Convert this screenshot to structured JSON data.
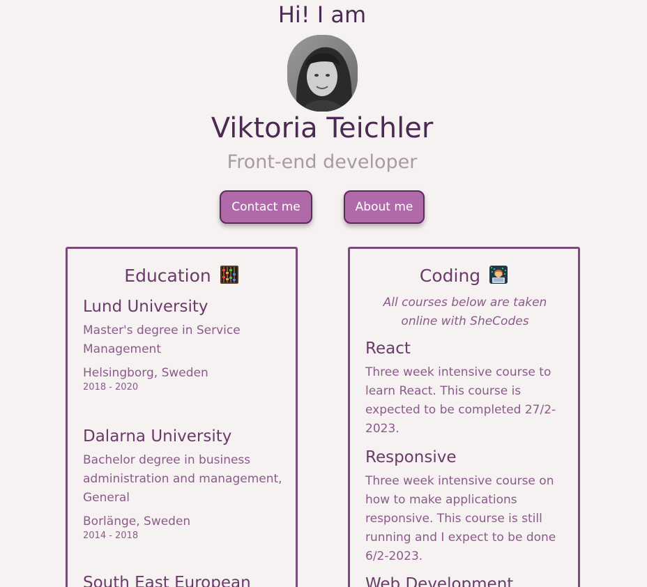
{
  "hero": {
    "greeting": "Hi! I am",
    "name": "Viktoria Teichler",
    "role": "Front-end developer"
  },
  "buttons": {
    "contact_label": "Contact me",
    "about_label": "About me"
  },
  "education": {
    "title": "Education",
    "icon": "abacus-icon",
    "items": [
      {
        "school": "Lund University",
        "degree": "Master's degree in Service Management",
        "place": "Helsingborg, Sweden",
        "years": "2018 - 2020"
      },
      {
        "school": "Dalarna University",
        "degree": "Bachelor degree in business administration and management, General",
        "place": "Borlänge, Sweden",
        "years": "2014 - 2018"
      },
      {
        "school": "South East European"
      }
    ]
  },
  "coding": {
    "title": "Coding",
    "icon": "technologist-icon",
    "note": "All courses below are taken online with SheCodes",
    "items": [
      {
        "course": "React",
        "desc": "Three week intensive course to learn React. This course is expected to be completed 27/2-2023."
      },
      {
        "course": "Responsive",
        "desc": "Three week intensive course on how to make applications responsive. This course is still running and I expect to be done 6/2-2023."
      },
      {
        "course": "Web Development"
      }
    ]
  },
  "colors": {
    "background": "#f7f2f2",
    "accent": "#b06aaa",
    "heading": "#4a2a52",
    "muted": "#a89aa5",
    "card_border": "#7a4a7a"
  }
}
